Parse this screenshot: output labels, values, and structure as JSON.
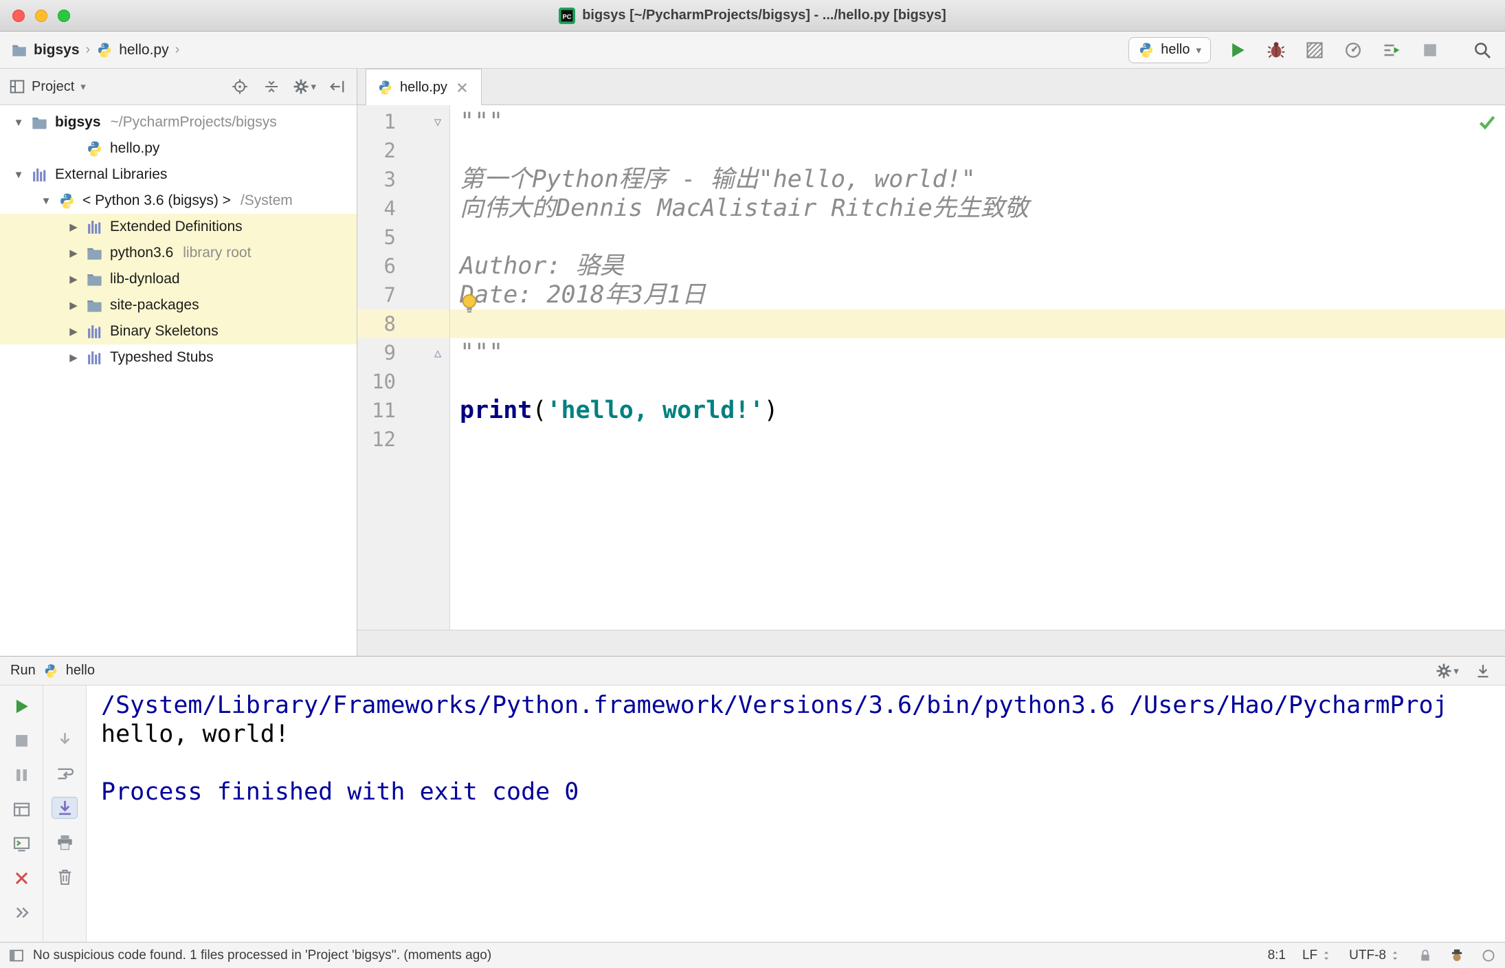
{
  "window": {
    "title": "bigsys [~/PycharmProjects/bigsys] - .../hello.py [bigsys]"
  },
  "navbar": {
    "breadcrumb": {
      "project": "bigsys",
      "file": "hello.py"
    },
    "run_config": {
      "label": "hello"
    },
    "actions": [
      {
        "name": "run",
        "icon": "play"
      },
      {
        "name": "debug",
        "icon": "bug"
      },
      {
        "name": "run-with-coverage",
        "icon": "coverage"
      },
      {
        "name": "profile",
        "icon": "profiler"
      },
      {
        "name": "concurrency-diagram",
        "icon": "concurrency"
      },
      {
        "name": "stop",
        "icon": "square"
      }
    ]
  },
  "project_panel": {
    "title": "Project",
    "header_actions": [
      {
        "name": "locate-file",
        "icon": "target"
      },
      {
        "name": "collapse-all",
        "icon": "collapse"
      },
      {
        "name": "settings",
        "icon": "gear",
        "chevron": true
      },
      {
        "name": "hide-panel",
        "icon": "hide"
      }
    ],
    "tree": [
      {
        "label": "bigsys",
        "suffix": "~/PycharmProjects/bigsys",
        "icon": "folder",
        "arrow": "down",
        "level": 0,
        "bold": true
      },
      {
        "label": "hello.py",
        "icon": "python",
        "arrow": "none",
        "level": 2
      },
      {
        "label": "External Libraries",
        "icon": "library",
        "arrow": "down",
        "level": 0
      },
      {
        "label": "< Python 3.6 (bigsys) >",
        "suffix": "/System",
        "icon": "python",
        "arrow": "down",
        "level": 1
      },
      {
        "label": "Extended Definitions",
        "icon": "library",
        "arrow": "right",
        "level": 2,
        "highlight": true
      },
      {
        "label": "python3.6",
        "suffix": "library root",
        "icon": "folder",
        "arrow": "right",
        "level": 2,
        "highlight": true
      },
      {
        "label": "lib-dynload",
        "icon": "folder",
        "arrow": "right",
        "level": 2,
        "highlight": true
      },
      {
        "label": "site-packages",
        "icon": "folder",
        "arrow": "right",
        "level": 2,
        "highlight": true
      },
      {
        "label": "Binary Skeletons",
        "icon": "library",
        "arrow": "right",
        "level": 2,
        "highlight": true
      },
      {
        "label": "Typeshed Stubs",
        "icon": "library",
        "arrow": "right",
        "level": 2
      }
    ]
  },
  "editor": {
    "tab": {
      "label": "hello.py"
    },
    "lines": [
      {
        "num": 1,
        "fold": "start",
        "segments": [
          {
            "style": "docstring",
            "text": "\"\"\""
          }
        ]
      },
      {
        "num": 2,
        "segments": []
      },
      {
        "num": 3,
        "segments": [
          {
            "style": "docstring",
            "text": "第一个Python程序 - 输出\"hello, world!\""
          }
        ]
      },
      {
        "num": 4,
        "segments": [
          {
            "style": "docstring",
            "text": "向伟大的Dennis MacAlistair Ritchie先生致敬"
          }
        ]
      },
      {
        "num": 5,
        "segments": []
      },
      {
        "num": 6,
        "segments": [
          {
            "style": "docstring",
            "text": "Author: 骆昊"
          }
        ]
      },
      {
        "num": 7,
        "segments": [
          {
            "style": "docstring",
            "text": "Date: 2018年3月1日"
          }
        ]
      },
      {
        "num": 8,
        "caret_line": true,
        "segments": []
      },
      {
        "num": 9,
        "fold": "end",
        "segments": [
          {
            "style": "docstring",
            "text": "\"\"\""
          }
        ]
      },
      {
        "num": 10,
        "segments": []
      },
      {
        "num": 11,
        "segments": [
          {
            "style": "keyword",
            "text": "print"
          },
          {
            "style": "plain",
            "text": "("
          },
          {
            "style": "string",
            "text": "'hello, world!'"
          },
          {
            "style": "plain",
            "text": ")"
          }
        ]
      },
      {
        "num": 12,
        "segments": []
      }
    ]
  },
  "run_panel": {
    "title": "Run",
    "config_label": "hello",
    "header_actions": [
      {
        "name": "settings",
        "icon": "gear",
        "chevron": true
      },
      {
        "name": "dock",
        "icon": "dock"
      }
    ],
    "toolbar_main": [
      {
        "name": "rerun",
        "icon": "play"
      },
      {
        "name": "stop",
        "icon": "square"
      },
      {
        "name": "pause-output",
        "icon": "pause"
      },
      {
        "name": "restore-layout",
        "icon": "layout"
      },
      {
        "name": "show-python-prompt",
        "icon": "console"
      },
      {
        "name": "close",
        "icon": "close-red"
      },
      {
        "name": "more-options",
        "icon": "more"
      }
    ],
    "toolbar_console": [
      {
        "name": "down-the-stacktrace",
        "icon": "arrow-down"
      },
      {
        "name": "soft-wrap",
        "icon": "softwrap"
      },
      {
        "name": "scroll-to-end",
        "icon": "scroll-end",
        "selected": true
      },
      {
        "name": "print",
        "icon": "printer"
      },
      {
        "name": "clear-all",
        "icon": "trash"
      }
    ],
    "console": [
      {
        "stream": "system",
        "text": "/System/Library/Frameworks/Python.framework/Versions/3.6/bin/python3.6 /Users/Hao/PycharmProj"
      },
      {
        "stream": "stdout",
        "text": "hello, world!"
      },
      {
        "stream": "stdout",
        "text": ""
      },
      {
        "stream": "system",
        "text": "Process finished with exit code 0"
      }
    ]
  },
  "status_bar": {
    "message": "No suspicious code found. 1 files processed in 'Project 'bigsys''. (moments ago)",
    "caret_position": "8:1",
    "line_separator": "LF",
    "encoding": "UTF-8"
  },
  "colors": {
    "accent_green": "#3b9b41",
    "caret_line": "#fcf5d2",
    "tree_highlight": "#fbf7d0",
    "docstring": "#8c8c8c",
    "keyword": "#000080",
    "string": "#008080",
    "console_system": "#00009b",
    "check_green": "#59b659"
  }
}
